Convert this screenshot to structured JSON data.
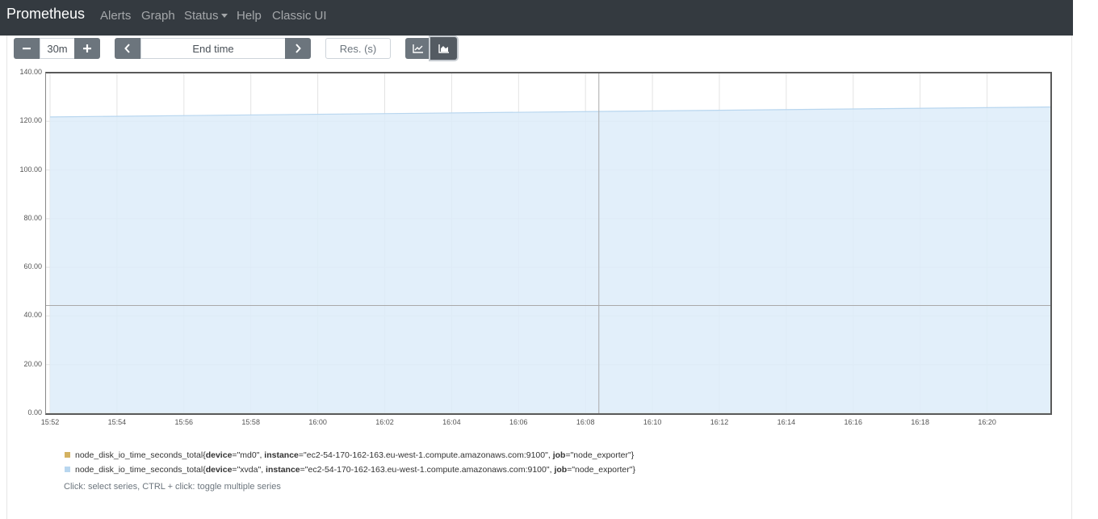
{
  "navbar": {
    "brand": "Prometheus",
    "links": [
      "Alerts",
      "Graph",
      "Status",
      "Help",
      "Classic UI"
    ],
    "bg_color": "#343a40"
  },
  "controls": {
    "minus_icon": "minus-icon",
    "range_value": "30m",
    "plus_icon": "plus-icon",
    "prev_icon": "chevron-left-icon",
    "end_time_placeholder": "End time",
    "next_icon": "chevron-right-icon",
    "resolution_placeholder": "Res. (s)",
    "line_chart_icon": "line-chart-icon",
    "stacked_chart_icon": "area-chart-icon",
    "active_chart_mode": "stacked"
  },
  "chart_data": {
    "type": "area",
    "stacked": true,
    "x_tick_labels": [
      "15:52",
      "15:54",
      "15:56",
      "15:58",
      "16:00",
      "16:02",
      "16:04",
      "16:06",
      "16:08",
      "16:10",
      "16:12",
      "16:14",
      "16:16",
      "16:18",
      "16:20"
    ],
    "y_tick_labels": [
      "0.00",
      "20.00",
      "40.00",
      "60.00",
      "80.00",
      "100.00",
      "120.00",
      "140.00"
    ],
    "ylim": [
      0,
      140
    ],
    "x_range_minutes": [
      0,
      30
    ],
    "x_start_label": "15:52",
    "series": [
      {
        "name": "node_disk_io_time_seconds_total{device=\"md0\", instance=\"ec2-54-170-162-163.eu-west-1.compute.amazonaws.com:9100\", job=\"node_exporter\"}",
        "color": "#d4b261",
        "x": [
          0,
          30
        ],
        "values": [
          0.0,
          0.0
        ]
      },
      {
        "name": "node_disk_io_time_seconds_total{device=\"xvda\", instance=\"ec2-54-170-162-163.eu-west-1.compute.amazonaws.com:9100\", job=\"node_exporter\"}",
        "color": "#b8d6ef",
        "fill": "#ddecf9",
        "x": [
          0,
          30
        ],
        "values": [
          121.8,
          125.9
        ]
      }
    ],
    "grid": true,
    "hover_crosshair": {
      "x_minutes": 16.4,
      "y_value": 44.3
    }
  },
  "legend": {
    "items": [
      {
        "metric": "node_disk_io_time_seconds_total",
        "open": "{",
        "labels": [
          {
            "k": "device",
            "v": "\"md0\""
          },
          {
            "k": "instance",
            "v": "\"ec2-54-170-162-163.eu-west-1.compute.amazonaws.com:9100\""
          },
          {
            "k": "job",
            "v": "\"node_exporter\""
          }
        ],
        "close": "}",
        "color": "#d4b261"
      },
      {
        "metric": "node_disk_io_time_seconds_total",
        "open": "{",
        "labels": [
          {
            "k": "device",
            "v": "\"xvda\""
          },
          {
            "k": "instance",
            "v": "\"ec2-54-170-162-163.eu-west-1.compute.amazonaws.com:9100\""
          },
          {
            "k": "job",
            "v": "\"node_exporter\""
          }
        ],
        "close": "}",
        "color": "#b8d6ef"
      }
    ],
    "hint": "Click: select series, CTRL + click: toggle multiple series"
  }
}
